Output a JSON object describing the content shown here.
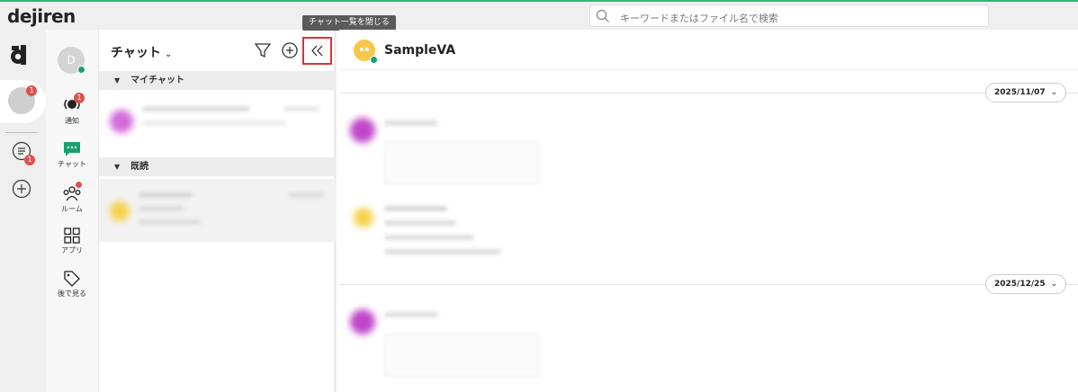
{
  "app": {
    "logo": "dejiren",
    "search_placeholder": "キーワードまたはファイル名で検索"
  },
  "workspace_rail": {
    "active_badge": "1",
    "list_badge": "1"
  },
  "nav": {
    "avatar_letter": "D",
    "items": [
      {
        "label": "通知",
        "badge": "1"
      },
      {
        "label": "チャット"
      },
      {
        "label": "ルーム"
      },
      {
        "label": "アプリ"
      },
      {
        "label": "後で見る"
      }
    ]
  },
  "panel": {
    "title": "チャット",
    "tooltip": "チャット一覧を閉じる",
    "sections": [
      {
        "label": "マイチャット"
      },
      {
        "label": "既読"
      }
    ]
  },
  "chat": {
    "title": "SampleVA",
    "dates": [
      "2025/11/07",
      "2025/12/25"
    ]
  },
  "colors": {
    "accent": "#2eb872",
    "badge": "#d9534f",
    "online": "#1aa06d",
    "highlight": "#e03030"
  }
}
